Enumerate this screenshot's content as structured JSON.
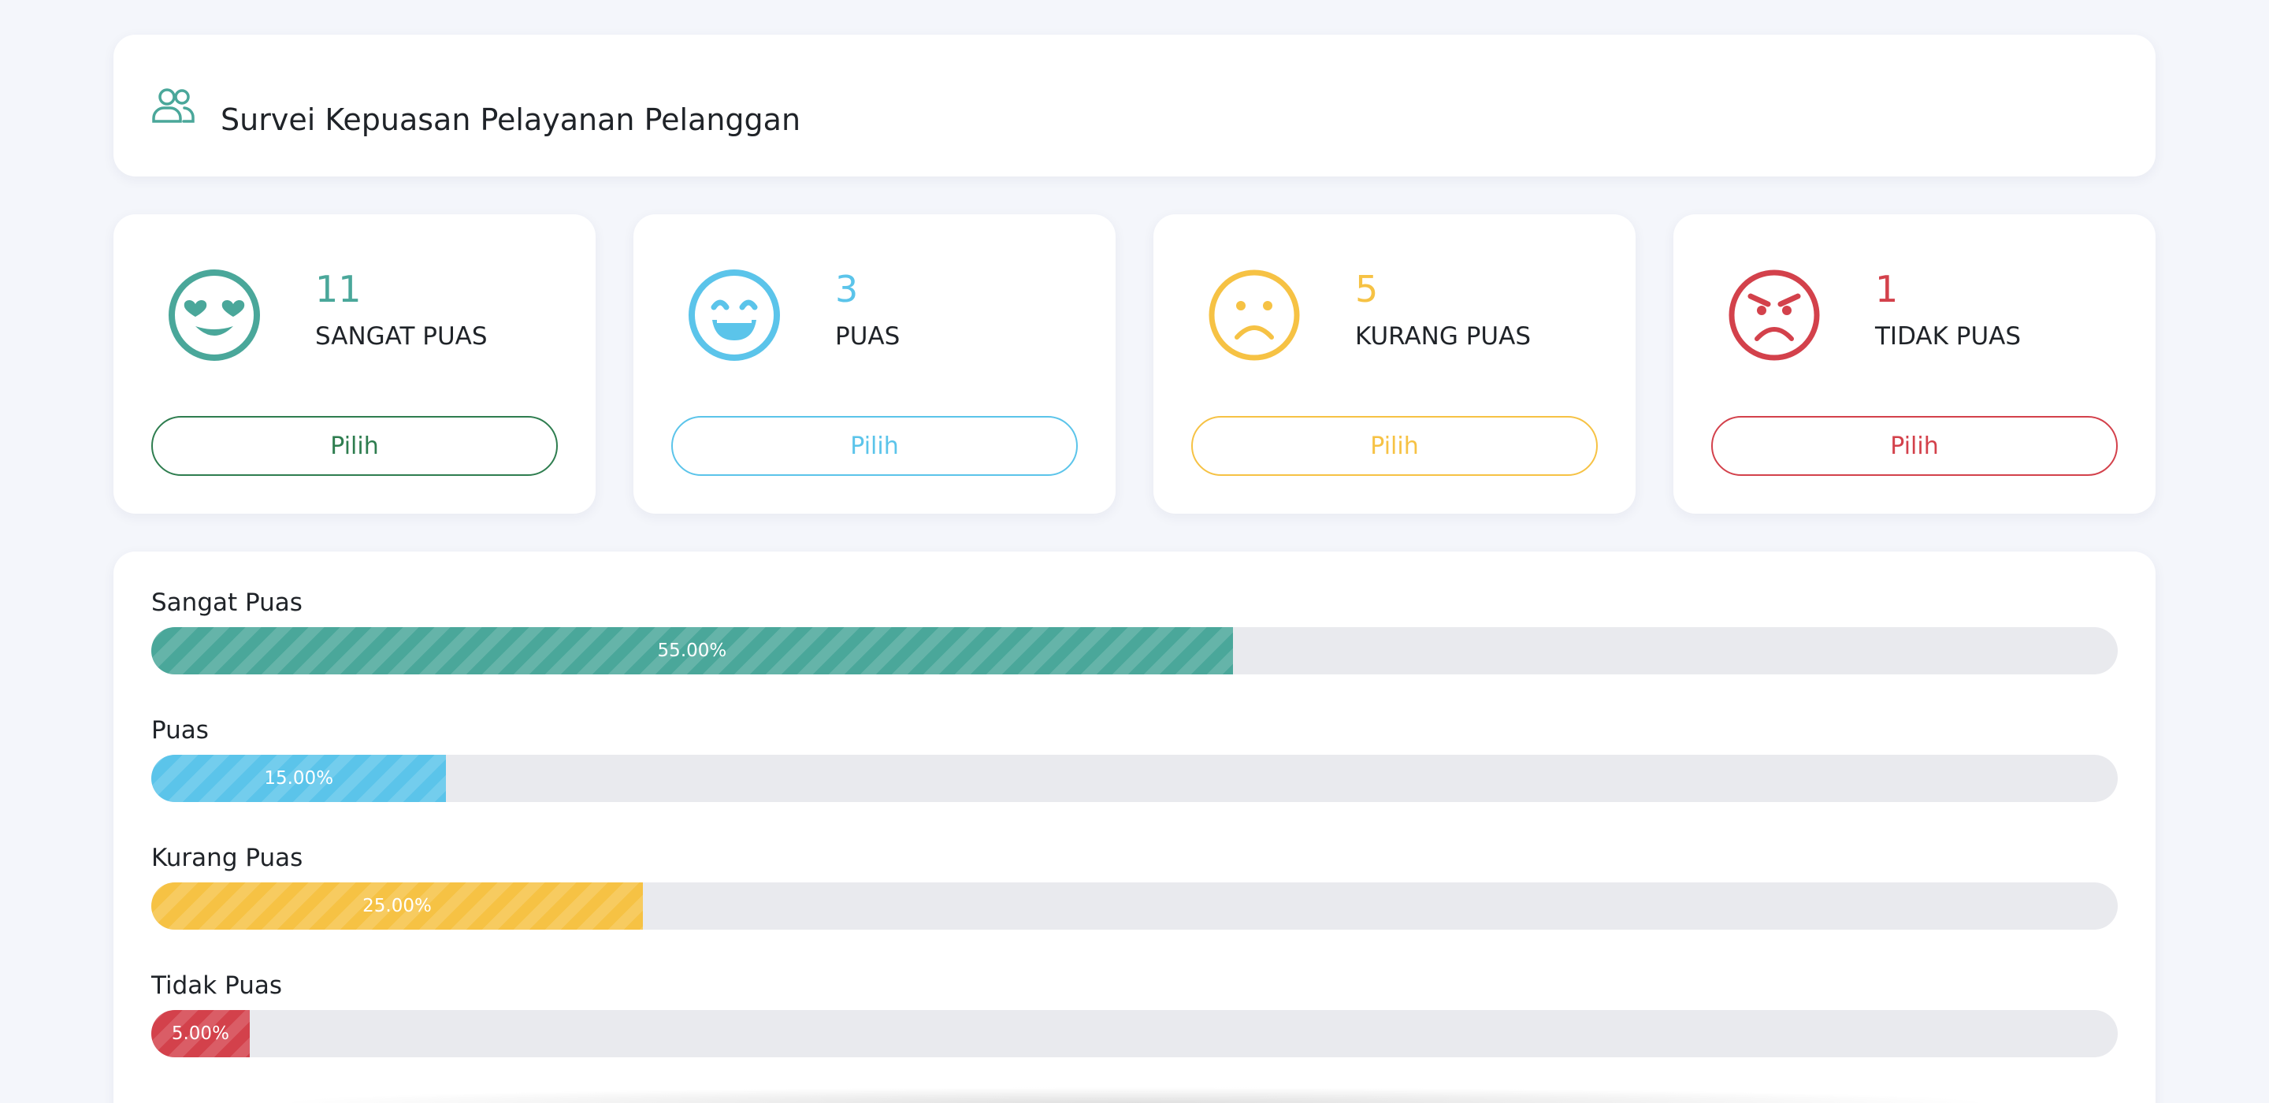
{
  "header": {
    "title": "Survei Kepuasan Pelayanan Pelanggan",
    "icon": "users-icon",
    "icon_color": "#4aa79a"
  },
  "stats": [
    {
      "key": "sangat-puas",
      "count": "11",
      "label": "SANGAT PUAS",
      "button": "Pilih",
      "icon": "heart-eyes-face-icon",
      "color": "#4aa79a",
      "button_color": "#2e7d4f"
    },
    {
      "key": "puas",
      "count": "3",
      "label": "PUAS",
      "button": "Pilih",
      "icon": "grinning-face-icon",
      "color": "#5bc4ea",
      "button_color": "#5bc4ea"
    },
    {
      "key": "kurang-puas",
      "count": "5",
      "label": "KURANG PUAS",
      "button": "Pilih",
      "icon": "frowning-face-icon",
      "color": "#f6c244",
      "button_color": "#f6c244"
    },
    {
      "key": "tidak-puas",
      "count": "1",
      "label": "TIDAK PUAS",
      "button": "Pilih",
      "icon": "angry-face-icon",
      "color": "#d3414b",
      "button_color": "#d3414b"
    }
  ],
  "progress": [
    {
      "label": "Sangat Puas",
      "percent_text": "55.00%",
      "value": 55,
      "color": "#4aa79a"
    },
    {
      "label": "Puas",
      "percent_text": "15.00%",
      "value": 15,
      "color": "#5bc4ea"
    },
    {
      "label": "Kurang Puas",
      "percent_text": "25.00%",
      "value": 25,
      "color": "#f6c244"
    },
    {
      "label": "Tidak Puas",
      "percent_text": "5.00%",
      "value": 5,
      "color": "#d3414b"
    }
  ]
}
